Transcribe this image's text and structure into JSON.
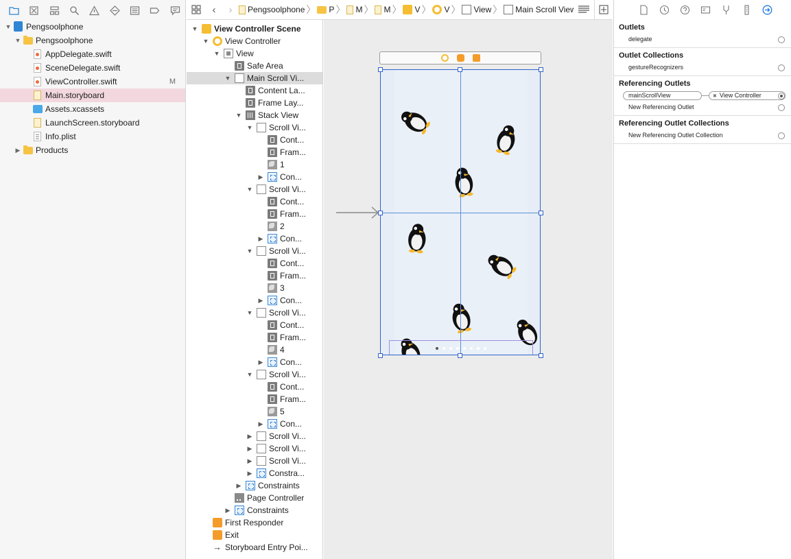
{
  "navigator": {
    "items": [
      {
        "label": "Pengsoolphone",
        "indent": 0,
        "icon": "project-icon",
        "disclosure": "▼",
        "badge": ""
      },
      {
        "label": "Pengsoolphone",
        "indent": 1,
        "icon": "folder-icon",
        "disclosure": "▼",
        "badge": ""
      },
      {
        "label": "AppDelegate.swift",
        "indent": 2,
        "icon": "swift-file-icon",
        "disclosure": "",
        "badge": ""
      },
      {
        "label": "SceneDelegate.swift",
        "indent": 2,
        "icon": "swift-file-icon",
        "disclosure": "",
        "badge": ""
      },
      {
        "label": "ViewController.swift",
        "indent": 2,
        "icon": "swift-file-icon",
        "disclosure": "",
        "badge": "M"
      },
      {
        "label": "Main.storyboard",
        "indent": 2,
        "icon": "storyboard-file-icon",
        "disclosure": "",
        "badge": "",
        "selected": true
      },
      {
        "label": "Assets.xcassets",
        "indent": 2,
        "icon": "asset-catalog-icon",
        "disclosure": "",
        "badge": ""
      },
      {
        "label": "LaunchScreen.storyboard",
        "indent": 2,
        "icon": "storyboard-file-icon",
        "disclosure": "",
        "badge": ""
      },
      {
        "label": "Info.plist",
        "indent": 2,
        "icon": "plist-file-icon",
        "disclosure": "",
        "badge": ""
      },
      {
        "label": "Products",
        "indent": 1,
        "icon": "folder-icon",
        "disclosure": "▶",
        "badge": ""
      }
    ]
  },
  "jumpbar": {
    "crumbs": [
      {
        "label": "Pengsoolphone",
        "icon": "storyboard-file-icon"
      },
      {
        "label": "P",
        "icon": "folder-icon"
      },
      {
        "label": "M",
        "icon": "storyboard-file-icon"
      },
      {
        "label": "M",
        "icon": "storyboard-file-icon"
      },
      {
        "label": "V",
        "icon": "scene-icon"
      },
      {
        "label": "V",
        "icon": "view-controller-icon"
      },
      {
        "label": "View",
        "icon": "view-icon"
      },
      {
        "label": "Main Scroll View",
        "icon": "scroll-view-icon"
      }
    ]
  },
  "outline": {
    "rows": [
      {
        "label": "View Controller Scene",
        "indent": 0,
        "icon": "scene",
        "disclosure": "▼",
        "bold": true
      },
      {
        "label": "View Controller",
        "indent": 1,
        "icon": "vc",
        "disclosure": "▼"
      },
      {
        "label": "View",
        "indent": 2,
        "icon": "view",
        "disclosure": "▼"
      },
      {
        "label": "Safe Area",
        "indent": 3,
        "icon": "guide",
        "disclosure": ""
      },
      {
        "label": "Main Scroll Vi...",
        "indent": 3,
        "icon": "plain",
        "disclosure": "▼",
        "selected": true
      },
      {
        "label": "Content La...",
        "indent": 4,
        "icon": "guide",
        "disclosure": ""
      },
      {
        "label": "Frame Lay...",
        "indent": 4,
        "icon": "guide",
        "disclosure": ""
      },
      {
        "label": "Stack View",
        "indent": 4,
        "icon": "stack",
        "disclosure": "▼"
      },
      {
        "label": "Scroll Vi...",
        "indent": 5,
        "icon": "plain",
        "disclosure": "▼"
      },
      {
        "label": "Cont...",
        "indent": 6,
        "icon": "guide",
        "disclosure": ""
      },
      {
        "label": "Fram...",
        "indent": 6,
        "icon": "guide",
        "disclosure": ""
      },
      {
        "label": "1",
        "indent": 6,
        "icon": "image",
        "disclosure": ""
      },
      {
        "label": "Con...",
        "indent": 6,
        "icon": "constraint",
        "disclosure": "▶"
      },
      {
        "label": "Scroll Vi...",
        "indent": 5,
        "icon": "plain",
        "disclosure": "▼"
      },
      {
        "label": "Cont...",
        "indent": 6,
        "icon": "guide",
        "disclosure": ""
      },
      {
        "label": "Fram...",
        "indent": 6,
        "icon": "guide",
        "disclosure": ""
      },
      {
        "label": "2",
        "indent": 6,
        "icon": "image",
        "disclosure": ""
      },
      {
        "label": "Con...",
        "indent": 6,
        "icon": "constraint",
        "disclosure": "▶"
      },
      {
        "label": "Scroll Vi...",
        "indent": 5,
        "icon": "plain",
        "disclosure": "▼"
      },
      {
        "label": "Cont...",
        "indent": 6,
        "icon": "guide",
        "disclosure": ""
      },
      {
        "label": "Fram...",
        "indent": 6,
        "icon": "guide",
        "disclosure": ""
      },
      {
        "label": "3",
        "indent": 6,
        "icon": "image",
        "disclosure": ""
      },
      {
        "label": "Con...",
        "indent": 6,
        "icon": "constraint",
        "disclosure": "▶"
      },
      {
        "label": "Scroll Vi...",
        "indent": 5,
        "icon": "plain",
        "disclosure": "▼"
      },
      {
        "label": "Cont...",
        "indent": 6,
        "icon": "guide",
        "disclosure": ""
      },
      {
        "label": "Fram...",
        "indent": 6,
        "icon": "guide",
        "disclosure": ""
      },
      {
        "label": "4",
        "indent": 6,
        "icon": "image",
        "disclosure": ""
      },
      {
        "label": "Con...",
        "indent": 6,
        "icon": "constraint",
        "disclosure": "▶"
      },
      {
        "label": "Scroll Vi...",
        "indent": 5,
        "icon": "plain",
        "disclosure": "▼"
      },
      {
        "label": "Cont...",
        "indent": 6,
        "icon": "guide",
        "disclosure": ""
      },
      {
        "label": "Fram...",
        "indent": 6,
        "icon": "guide",
        "disclosure": ""
      },
      {
        "label": "5",
        "indent": 6,
        "icon": "image",
        "disclosure": ""
      },
      {
        "label": "Con...",
        "indent": 6,
        "icon": "constraint",
        "disclosure": "▶"
      },
      {
        "label": "Scroll Vi...",
        "indent": 5,
        "icon": "plain",
        "disclosure": "▶"
      },
      {
        "label": "Scroll Vi...",
        "indent": 5,
        "icon": "plain",
        "disclosure": "▶"
      },
      {
        "label": "Scroll Vi...",
        "indent": 5,
        "icon": "plain",
        "disclosure": "▶"
      },
      {
        "label": "Constra...",
        "indent": 5,
        "icon": "constraint",
        "disclosure": "▶"
      },
      {
        "label": "Constraints",
        "indent": 4,
        "icon": "constraint",
        "disclosure": "▶"
      },
      {
        "label": "Page Controller",
        "indent": 3,
        "icon": "pagectl",
        "disclosure": ""
      },
      {
        "label": "Constraints",
        "indent": 3,
        "icon": "constraint",
        "disclosure": "▶"
      },
      {
        "label": "First Responder",
        "indent": 1,
        "icon": "responder",
        "disclosure": ""
      },
      {
        "label": "Exit",
        "indent": 1,
        "icon": "exit",
        "disclosure": ""
      },
      {
        "label": "Storyboard Entry Poi...",
        "indent": 1,
        "icon": "arrow",
        "disclosure": ""
      }
    ]
  },
  "canvas": {
    "page_count": 8,
    "current_page": 1
  },
  "inspector": {
    "outlets_title": "Outlets",
    "outlets": [
      {
        "label": "delegate"
      }
    ],
    "outlet_collections_title": "Outlet Collections",
    "outlet_collections": [
      {
        "label": "gestureRecognizers"
      }
    ],
    "referencing_outlets_title": "Referencing Outlets",
    "referencing_outlet": {
      "source": "mainScrollView",
      "target": "View Controller",
      "remove_glyph": "✖"
    },
    "new_referencing_outlet": "New Referencing Outlet",
    "referencing_collections_title": "Referencing Outlet Collections",
    "new_referencing_collection": "New Referencing Outlet Collection"
  },
  "colors": {
    "selection_navigator": "#f2d8de",
    "selection_outline": "#dcdcdc",
    "accent_blue": "#2f62c9",
    "folder_yellow": "#f6c343"
  }
}
